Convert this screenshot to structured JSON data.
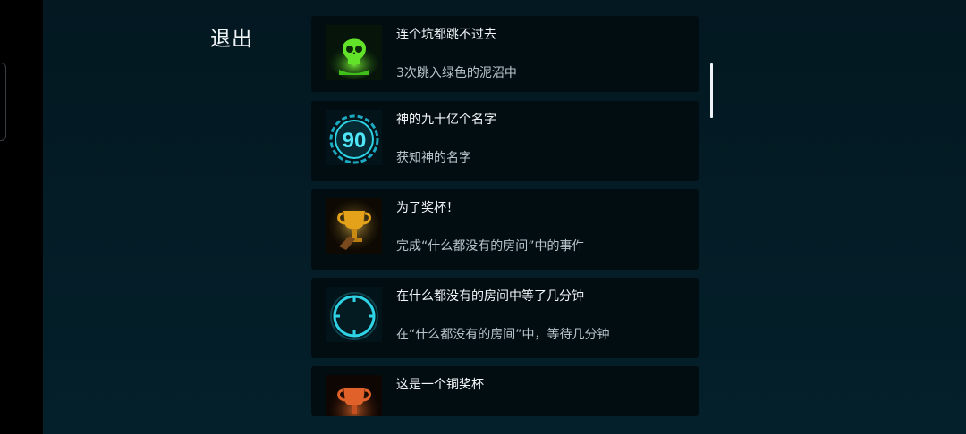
{
  "header": {
    "exit_label": "退出"
  },
  "achievements": [
    {
      "title": "连个坑都跳不过去",
      "description": "3次跳入绿色的泥沼中",
      "icon": "green-skull-icon"
    },
    {
      "title": "神的九十亿个名字",
      "description": "获知神的名字",
      "icon": "ninety-badge-icon",
      "icon_text": "90"
    },
    {
      "title": "为了奖杯！",
      "description": "完成“什么都没有的房间”中的事件",
      "icon": "gold-trophy-icon"
    },
    {
      "title": "在什么都没有的房间中等了几分钟",
      "description": "在“什么都没有的房间”中，等待几分钟",
      "icon": "clock-ring-icon"
    },
    {
      "title": "这是一个铜奖杯",
      "description": "",
      "icon": "bronze-trophy-icon"
    }
  ],
  "colors": {
    "background": "#041821",
    "card": "#020d12",
    "accent_cyan": "#2fd3e6",
    "skull_green": "#49d21b",
    "gold": "#e3a219",
    "bronze": "#e0622a"
  }
}
